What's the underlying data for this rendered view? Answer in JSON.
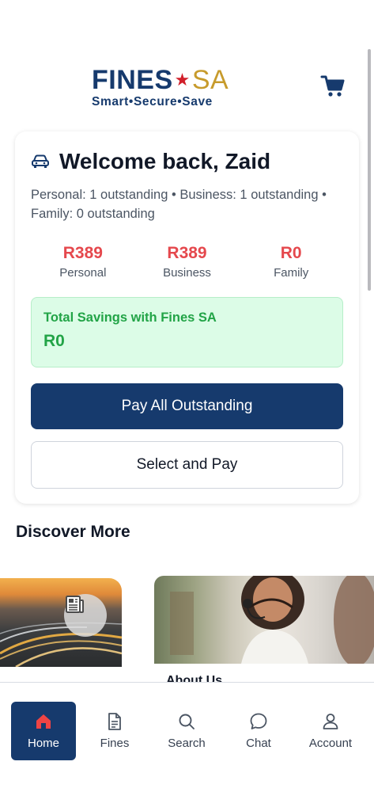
{
  "header": {
    "logo_fines": "FINES",
    "logo_star": "★",
    "logo_sa": "SA",
    "logo_tagline": "Smart•Secure•Save",
    "cart_icon": "cart-icon"
  },
  "welcome_card": {
    "title": "Welcome back, Zaid",
    "summary": "Personal: 1 outstanding • Business: 1 outstanding • Family: 0 outstanding",
    "stats": [
      {
        "amount": "R389",
        "label": "Personal"
      },
      {
        "amount": "R389",
        "label": "Business"
      },
      {
        "amount": "R0",
        "label": "Family"
      }
    ],
    "savings_title": "Total Savings with Fines SA",
    "savings_value": "R0",
    "pay_all_label": "Pay All Outstanding",
    "select_pay_label": "Select and Pay"
  },
  "discover": {
    "title": "Discover More",
    "cards": [
      {
        "icon": "newspaper-icon"
      },
      {
        "caption": "About Us"
      }
    ]
  },
  "bottom_nav": {
    "items": [
      {
        "label": "Home",
        "icon": "home-icon",
        "active": true
      },
      {
        "label": "Fines",
        "icon": "document-icon"
      },
      {
        "label": "Search",
        "icon": "search-icon"
      },
      {
        "label": "Chat",
        "icon": "chat-icon"
      },
      {
        "label": "Account",
        "icon": "user-icon"
      }
    ]
  },
  "colors": {
    "brand_navy": "#163a6d",
    "brand_gold": "#c79b2c",
    "alert_red": "#e5484d",
    "success_green": "#22a447"
  }
}
